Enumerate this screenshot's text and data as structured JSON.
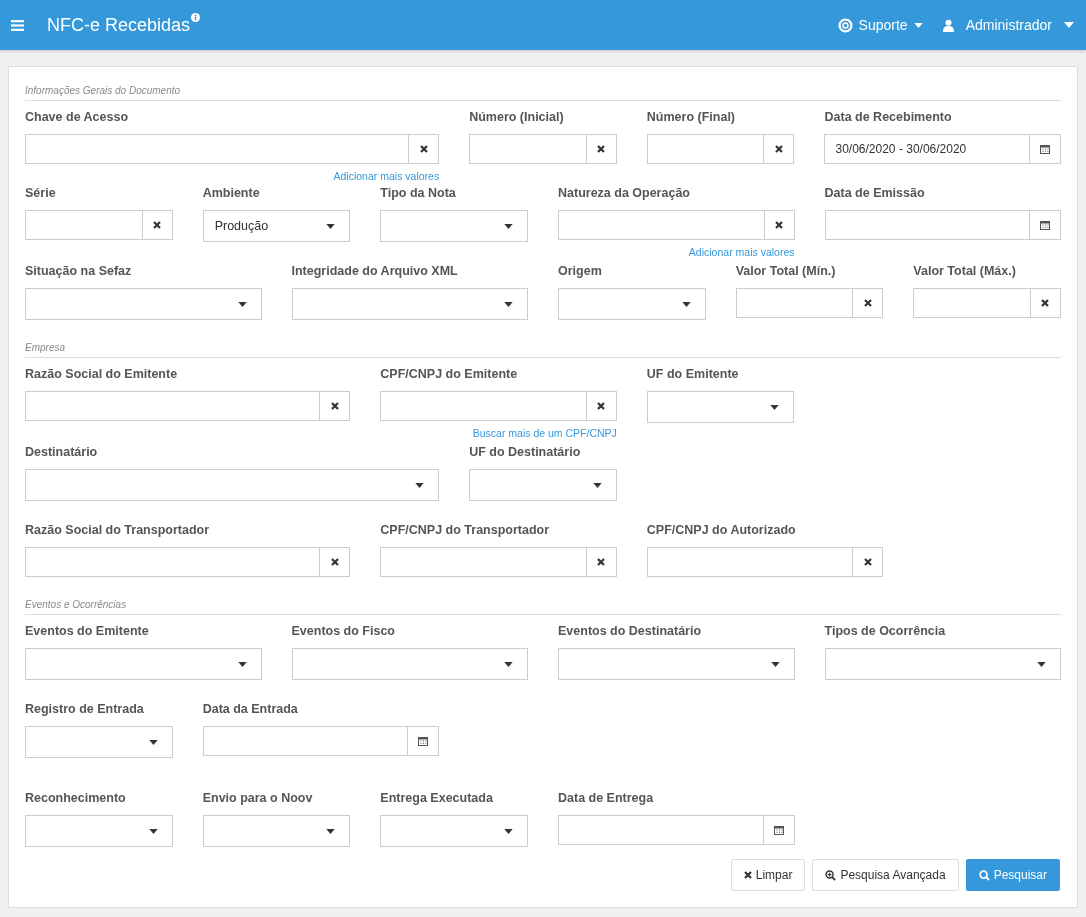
{
  "header": {
    "title": "NFC-e Recebidas",
    "support": "Suporte",
    "user": "Administrador"
  },
  "sections": [
    {
      "title": "Informações Gerais do Documento",
      "rows": [
        {
          "fields": [
            {
              "kind": "clear",
              "label": "Chave de Acesso",
              "link": "Adicionar mais valores"
            },
            {
              "kind": "clear",
              "label": "Número (Inicial)"
            },
            {
              "kind": "clear",
              "label": "Número (Final)"
            },
            {
              "kind": "date",
              "label": "Data de Recebimento",
              "value": "30/06/2020 - 30/06/2020"
            }
          ]
        },
        {
          "fields": [
            {
              "kind": "clear",
              "label": "Série"
            },
            {
              "kind": "select",
              "label": "Ambiente",
              "value": "Produção"
            },
            {
              "kind": "select",
              "label": "Tipo da Nota"
            },
            {
              "kind": "clear",
              "label": "Natureza da Operação",
              "link": "Adicionar mais valores"
            },
            {
              "kind": "date",
              "label": "Data de Emissão"
            }
          ]
        },
        {
          "fields": [
            {
              "kind": "select",
              "label": "Situação na Sefaz"
            },
            {
              "kind": "select",
              "label": "Integridade do Arquivo XML"
            },
            {
              "kind": "select",
              "label": "Origem"
            },
            {
              "kind": "clear",
              "label": "Valor Total (Mín.)"
            },
            {
              "kind": "clear",
              "label": "Valor Total (Máx.)"
            }
          ]
        }
      ]
    },
    {
      "title": "Empresa",
      "rows": [
        {
          "fields": [
            {
              "kind": "clear",
              "label": "Razão Social do Emitente"
            },
            {
              "kind": "clear",
              "label": "CPF/CNPJ do Emitente",
              "link": "Buscar mais de um CPF/CNPJ"
            },
            {
              "kind": "select",
              "label": "UF do Emitente"
            }
          ]
        },
        {
          "fields": [
            {
              "kind": "select",
              "label": "Destinatário"
            },
            {
              "kind": "select",
              "label": "UF do Destinatário"
            }
          ]
        },
        {
          "fields": [
            {
              "kind": "clear",
              "label": "Razão Social do Transportador"
            },
            {
              "kind": "clear",
              "label": "CPF/CNPJ do Transportador"
            },
            {
              "kind": "clear",
              "label": "CPF/CNPJ do Autorizado"
            }
          ]
        }
      ]
    },
    {
      "title": "Eventos e Ocorrências",
      "rows": [
        {
          "fields": [
            {
              "kind": "select",
              "label": "Eventos do Emitente"
            },
            {
              "kind": "select",
              "label": "Eventos do Fisco"
            },
            {
              "kind": "select",
              "label": "Eventos do Destinatário"
            },
            {
              "kind": "select",
              "label": "Tipos de Ocorrência"
            }
          ]
        },
        {
          "fields": [
            {
              "kind": "select",
              "label": "Registro de Entrada"
            },
            {
              "kind": "date",
              "label": "Data da Entrada"
            }
          ]
        },
        {
          "fields": [
            {
              "kind": "select",
              "label": "Reconhecimento"
            },
            {
              "kind": "select",
              "label": "Envio para o Noov"
            },
            {
              "kind": "select",
              "label": "Entrega Executada"
            },
            {
              "kind": "date",
              "label": "Data de Entrega"
            }
          ]
        }
      ]
    }
  ],
  "buttons": {
    "clear": "Limpar",
    "advanced": "Pesquisa Avançada",
    "search": "Pesquisar"
  }
}
